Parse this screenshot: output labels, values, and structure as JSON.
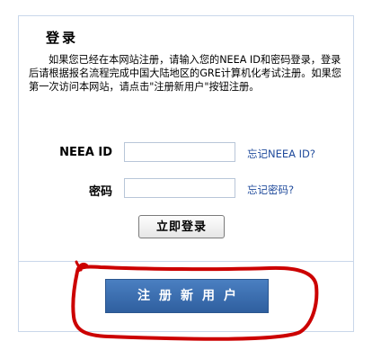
{
  "login": {
    "title": "登录",
    "description": "如果您已经在本网站注册，请输入您的NEEA ID和密码登录，登录后请根据报名流程完成中国大陆地区的GRE计算机化考试注册。如果您第一次访问本网站，请点击\"注册新用户\"按钮注册。",
    "neea_id_label": "NEEA ID",
    "neea_id_value": "",
    "forgot_id_link": "忘记NEEA ID?",
    "password_label": "密码",
    "password_value": "",
    "forgot_password_link": "忘记密码?",
    "login_button": "立即登录",
    "register_button": "注册新用户"
  },
  "annotation": {
    "stroke_color": "#cc0000"
  },
  "colors": {
    "panel_border": "#c9d7ea",
    "link": "#1f4a9b",
    "register_bg": "#3b6fb1"
  }
}
